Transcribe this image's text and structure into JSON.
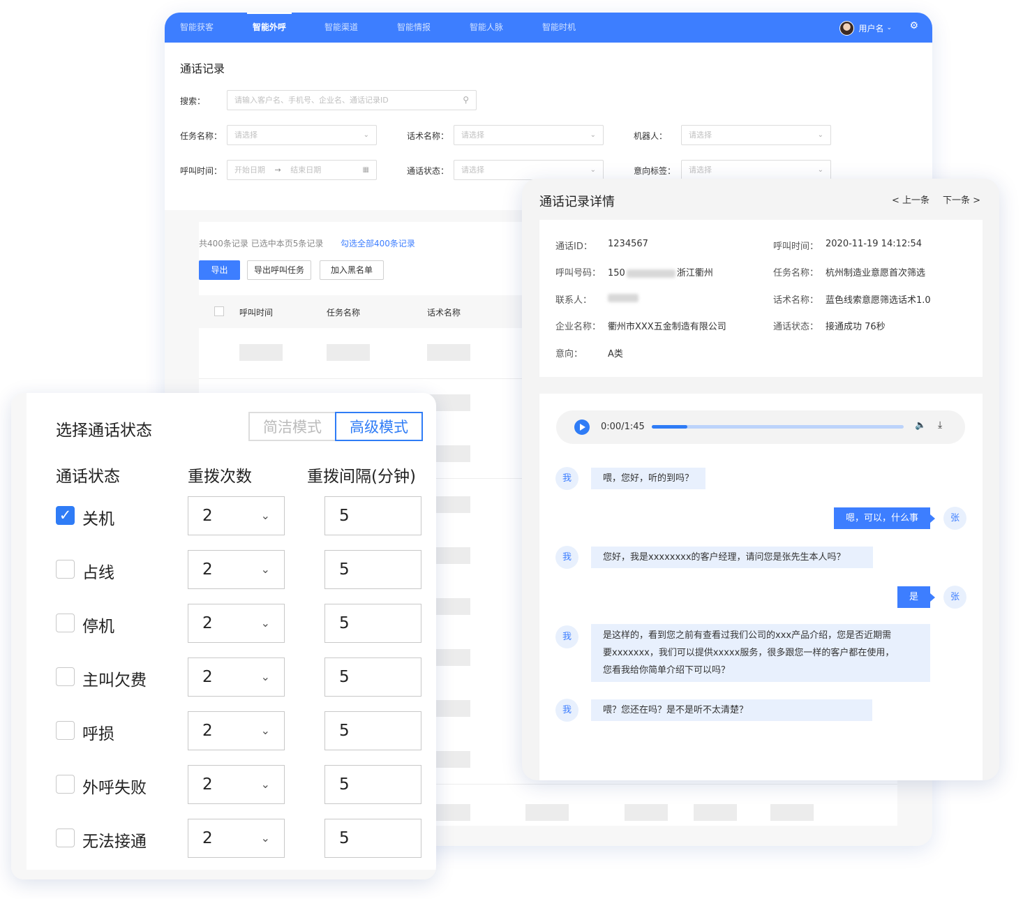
{
  "nav": {
    "tabs": [
      "智能获客",
      "智能外呼",
      "智能渠道",
      "智能情报",
      "智能人脉",
      "智能时机"
    ],
    "active": "智能外呼",
    "user": "用户名"
  },
  "filter": {
    "title": "通话记录",
    "search_label": "搜索：",
    "search_placeholder": "请输入客户名、手机号、企业名、通话记录ID",
    "task_label": "任务名称：",
    "script_label": "话术名称：",
    "robot_label": "机器人：",
    "time_label": "呼叫时间：",
    "status_label": "通话状态：",
    "tag_label": "意向标签：",
    "select_placeholder": "请选择",
    "start_date": "开始日期",
    "end_date": "结束日期",
    "arrow": "→"
  },
  "list": {
    "summary": "共400条记录  已选中本页5条记录",
    "select_all": "勾选全部400条记录",
    "btn_export": "导出",
    "btn_export_task": "导出呼叫任务",
    "btn_blacklist": "加入黑名单",
    "columns": [
      "呼叫时间",
      "任务名称",
      "话术名称"
    ]
  },
  "status_panel": {
    "title": "选择通话状态",
    "mode_simple": "简洁模式",
    "mode_advanced": "高级模式",
    "col_status": "通话状态",
    "col_retry": "重拨次数",
    "col_interval": "重拨间隔(分钟)",
    "rows": [
      {
        "label": "关机",
        "checked": true,
        "retry": "2",
        "interval": "5"
      },
      {
        "label": "占线",
        "checked": false,
        "retry": "2",
        "interval": "5"
      },
      {
        "label": "停机",
        "checked": false,
        "retry": "2",
        "interval": "5"
      },
      {
        "label": "主叫欠费",
        "checked": false,
        "retry": "2",
        "interval": "5"
      },
      {
        "label": "呼损",
        "checked": false,
        "retry": "2",
        "interval": "5"
      },
      {
        "label": "外呼失败",
        "checked": false,
        "retry": "2",
        "interval": "5"
      },
      {
        "label": "无法接通",
        "checked": false,
        "retry": "2",
        "interval": "5"
      }
    ]
  },
  "detail": {
    "title": "通话记录详情",
    "prev": "< 上一条",
    "next": "下一条 >",
    "call_id_label": "通话ID：",
    "call_id": "1234567",
    "call_time_label": "呼叫时间：",
    "call_time": "2020-11-19 14:12:54",
    "phone_label": "呼叫号码：",
    "phone_prefix": "150",
    "phone_region": "浙江衢州",
    "task_label": "任务名称：",
    "task": "杭州制造业意愿首次筛选",
    "contact_label": "联系人：",
    "script_label": "话术名称：",
    "script": "蓝色线索意愿筛选话术1.0",
    "company_label": "企业名称：",
    "company": "衢州市XXX五金制造有限公司",
    "status_label": "通话状态：",
    "status": "接通成功 76秒",
    "intent_label": "意向：",
    "intent": "A类",
    "player_time": "0:00/1:45",
    "player_progress": 0.14
  },
  "chat": [
    {
      "from": "我",
      "text": "喂，您好，听的到吗？"
    },
    {
      "from": "张",
      "text": "嗯，可以，什么事"
    },
    {
      "from": "我",
      "text": "您好，我是xxxxxxxx的客户经理，请问您是张先生本人吗？"
    },
    {
      "from": "张",
      "text": "是"
    },
    {
      "from": "我",
      "text": [
        "是这样的，看到您之前有查看过我们公司的xxx产品介绍，您是否近期需",
        "要xxxxxxx，我们可以提供xxxxx服务，很多跟您一样的客户都在使用，",
        "您看我给你简单介绍下可以吗？"
      ]
    },
    {
      "from": "我",
      "text": "喂？您还在吗？是不是听不太清楚？"
    }
  ]
}
